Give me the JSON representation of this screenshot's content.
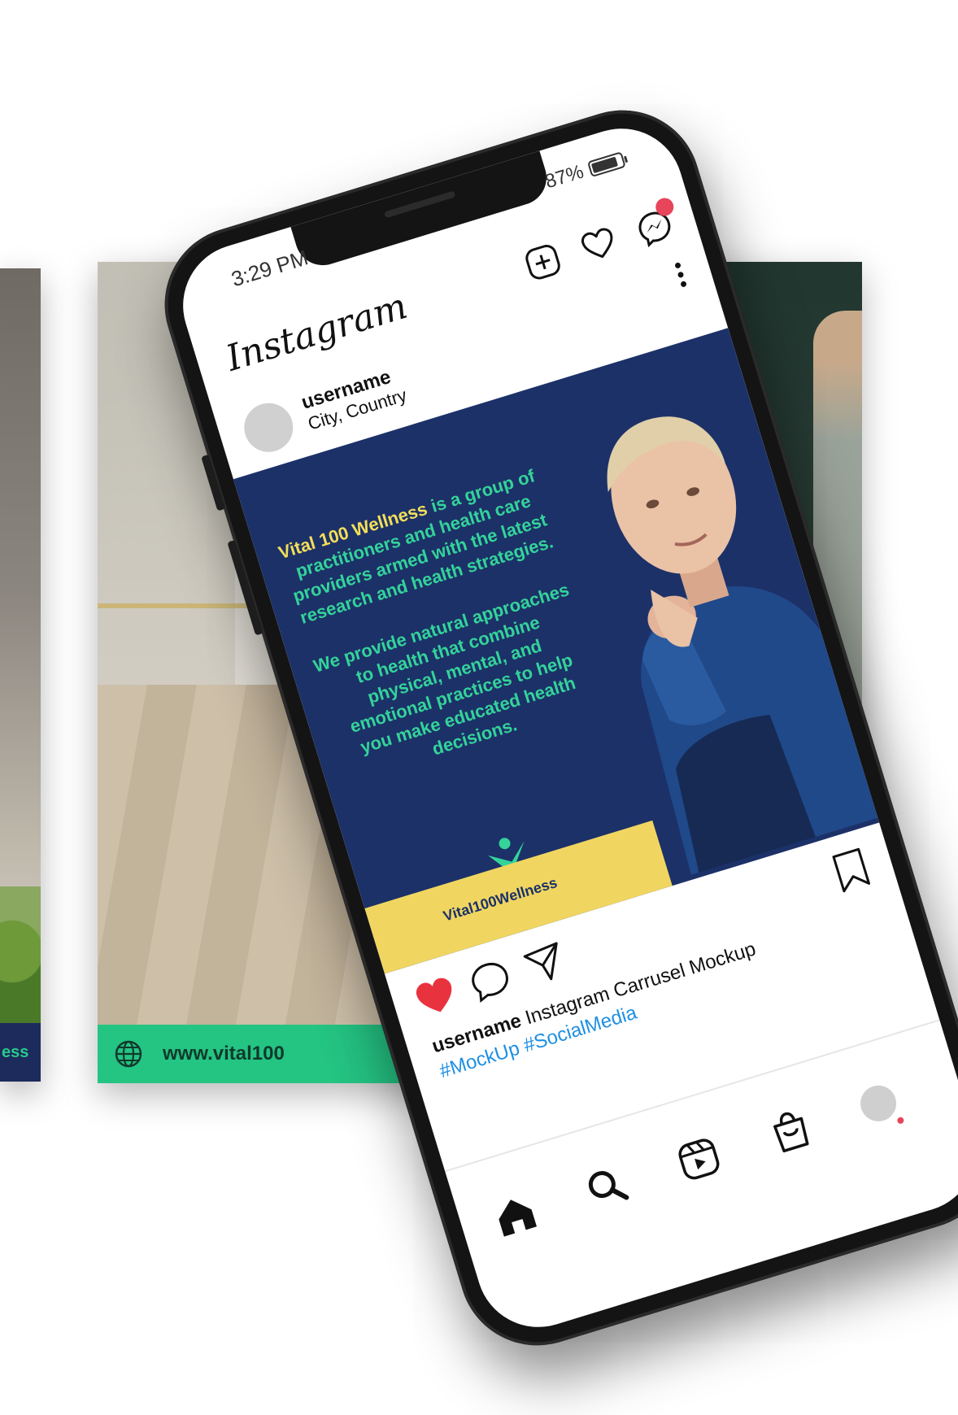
{
  "status_bar": {
    "time": "3:29 PM",
    "battery": "87%",
    "battery_level": 0.87
  },
  "header": {
    "logo": "Instagram",
    "icons": [
      "add-post-icon",
      "heart-icon",
      "messenger-icon"
    ]
  },
  "post": {
    "username": "username",
    "location": "City, Country",
    "image": {
      "brand_highlight": "Vital 100 Wellness",
      "paragraph1_rest": " is a group of practitioners and health care providers armed with the latest research and health strategies.",
      "paragraph2": "We provide natural approaches to health that combine physical, mental, and emotional practices to help you make educated health decisions.",
      "footer_logo": "Vital100Wellness"
    },
    "liked": true,
    "caption_user": "username",
    "caption_text": "Instagram Carrusel Mockup",
    "hashtags": "#MockUp #SocialMedia"
  },
  "bottom_nav": [
    "home-icon",
    "search-icon",
    "reels-icon",
    "shop-icon",
    "profile-avatar"
  ],
  "background_cards": {
    "left_strip_text": "ess",
    "mid_strip_url": "www.vital100"
  },
  "colors": {
    "navy": "#1c3168",
    "green": "#34d39a",
    "yellow": "#f2de5a",
    "like_red": "#e8333f",
    "hashtag_blue": "#1d8fe3"
  }
}
